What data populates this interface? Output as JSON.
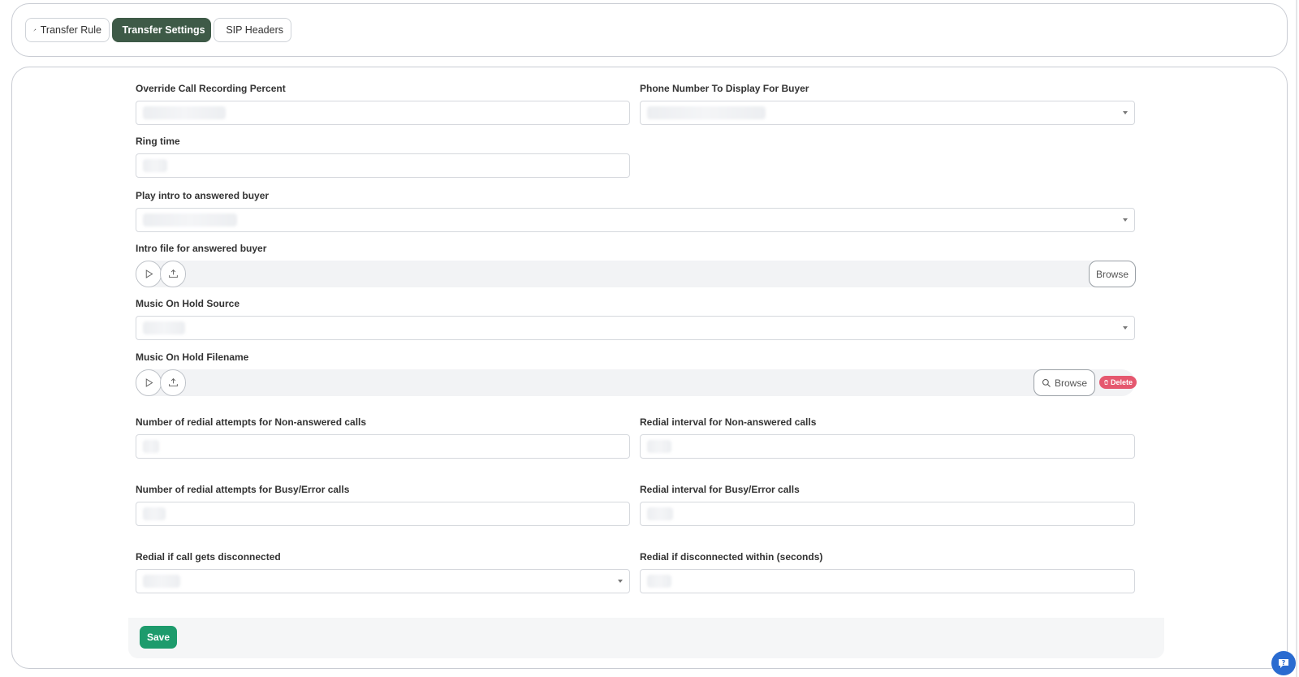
{
  "tabs": [
    {
      "label": "Transfer Rule",
      "icon": "wrench-icon"
    },
    {
      "label": "Transfer Settings",
      "icon": "gear-icon"
    },
    {
      "label": "SIP Headers",
      "icon": "phone-icon"
    }
  ],
  "active_tab": "Transfer Settings",
  "form": {
    "override_call_recording_percent": {
      "label": "Override Call Recording Percent"
    },
    "phone_number_to_display": {
      "label": "Phone Number To Display For Buyer"
    },
    "ring_time": {
      "label": "Ring time"
    },
    "play_intro": {
      "label": "Play intro to answered buyer"
    },
    "intro_file": {
      "label": "Intro file for answered buyer",
      "browse_label": "Browse"
    },
    "music_on_hold_source": {
      "label": "Music On Hold Source"
    },
    "music_on_hold_filename": {
      "label": "Music On Hold Filename",
      "browse_label": "Browse",
      "delete_label": "Delete"
    },
    "redial_attempts_non_answered": {
      "label": "Number of redial attempts for Non-answered calls"
    },
    "redial_interval_non_answered": {
      "label": "Redial interval for Non-answered calls"
    },
    "redial_attempts_busy": {
      "label": "Number of redial attempts for Busy/Error calls"
    },
    "redial_interval_busy": {
      "label": "Redial interval for Busy/Error calls"
    },
    "redial_if_disconnected": {
      "label": "Redial if call gets disconnected"
    },
    "redial_disconnected_within": {
      "label": "Redial if disconnected within (seconds)"
    }
  },
  "save_label": "Save",
  "colors": {
    "active_tab": "#3e5a47",
    "save": "#1d9b6c",
    "delete": "#e5586f",
    "help": "#2a6bd0"
  }
}
